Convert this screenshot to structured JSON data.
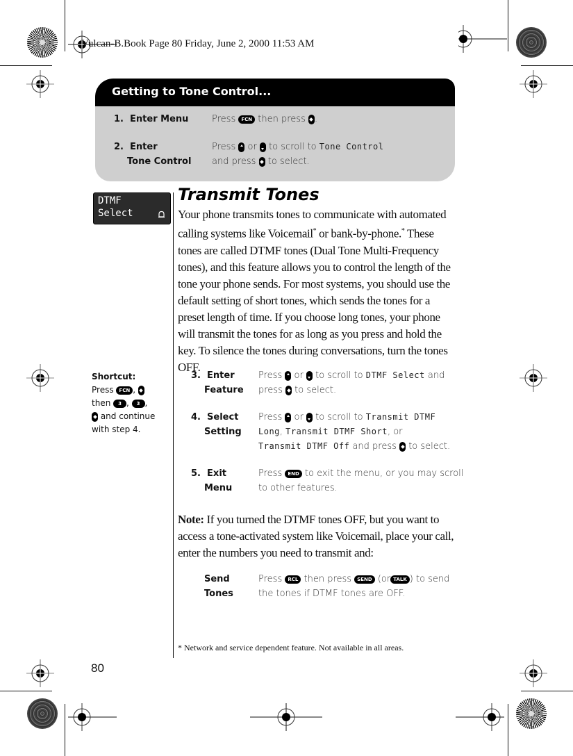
{
  "header": {
    "text": "Vulcan-B.Book  Page 80  Friday, June 2, 2000  11:53 AM"
  },
  "getting_to": {
    "title": "Getting to Tone Control...",
    "steps": [
      {
        "num": "1.",
        "label": "Enter Menu",
        "desc_parts": [
          "Press",
          "FCN",
          "then press",
          "."
        ]
      },
      {
        "num": "2.",
        "label_line1": "Enter",
        "label_line2": "Tone Control",
        "desc_line1_a": "Press",
        "desc_line1_b": "or",
        "desc_line1_c": "to scroll to",
        "desc_line1_lcd": "Tone Control",
        "desc_line2_a": "and press",
        "desc_line2_b": "to select."
      }
    ]
  },
  "display": {
    "line1": "DTMF",
    "line2": "Select",
    "icon": "bell-icon"
  },
  "section": {
    "title": "Transmit Tones",
    "paragraph_a": "Your phone transmits tones to communicate with automated calling systems like Voicemail",
    "paragraph_b": " or bank-by-phone.",
    "paragraph_c": " These tones are called DTMF tones (Dual Tone Multi-Frequency tones), and this feature allows you to control the length of the tone your phone sends. For most systems, you should use the default setting of short tones, which sends the tones for a preset length of time. If you choose long tones, your phone will transmit the tones for as long as you press and hold the key. To silence the tones during conversations, turn the tones OFF.",
    "footnote_mark": "*"
  },
  "shortcut": {
    "title": "Shortcut:",
    "press": "Press",
    "fcn": "FCN",
    "then": "then",
    "key3": "3",
    "and_continue": "and continue with step 4."
  },
  "steps": [
    {
      "num": "3.",
      "label_line1": "Enter",
      "label_line2": "Feature",
      "l1_a": "Press",
      "l1_b": "or",
      "l1_c": "to scroll to",
      "l1_lcd": "DTMF Select",
      "l1_d": "and",
      "l2_a": "press",
      "l2_b": "to select."
    },
    {
      "num": "4.",
      "label_line1": "Select",
      "label_line2": "Setting",
      "l1_a": "Press",
      "l1_b": "or",
      "l1_c": "to scroll to",
      "l1_lcd": "Transmit DTMF",
      "l2_lcd": "Long",
      "l2_a": ", ",
      "l2_lcd2": "Transmit DTMF Short",
      "l2_b": ", or",
      "l3_lcd": "Transmit DTMF Off",
      "l3_a": "and press",
      "l3_b": "to select."
    },
    {
      "num": "5.",
      "label_line1": "Exit",
      "label_line2": "Menu",
      "l1_a": "Press",
      "l1_key": "END",
      "l1_b": "to exit the menu, or you may scroll",
      "l2_a": "to other features."
    }
  ],
  "note": {
    "label": "Note:",
    "text": " If you turned the DTMF tones OFF, but you want to access a tone-activated system like Voicemail, place your call, enter the numbers you need to transmit and:"
  },
  "send_tones": {
    "label_line1": "Send",
    "label_line2": "Tones",
    "l1_a": "Press",
    "key_rcl": "RCL",
    "l1_b": "then press",
    "key_send": "SEND",
    "l1_c": "(or",
    "key_talk": "TALK",
    "l1_d": ") to send",
    "l2": "the tones if DTMF tones are OFF."
  },
  "footnote": {
    "mark": "*",
    "text": "Network and service dependent feature. Not available in all areas."
  },
  "page_number": "80"
}
